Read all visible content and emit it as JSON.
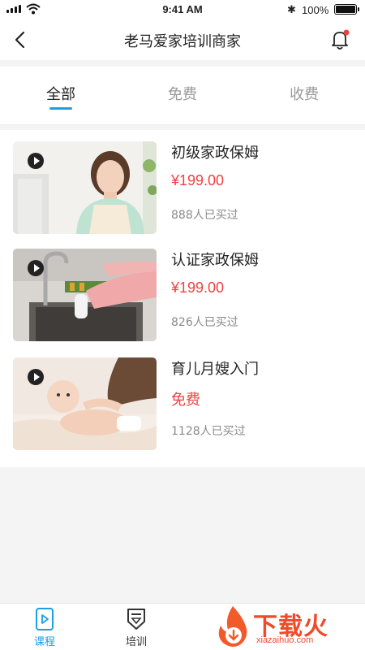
{
  "status_bar": {
    "time": "9:41 AM",
    "battery_percent": "100%",
    "battery_level": 1.0,
    "icons": [
      "signal-icon",
      "wifi-icon",
      "bluetooth-icon",
      "battery-icon"
    ]
  },
  "nav": {
    "title": "老马爱家培训商家",
    "back_icon": "back-arrow-icon",
    "bell_icon": "bell-icon",
    "bell_badge_color": "#f04141"
  },
  "tabs": [
    {
      "label": "全部",
      "active": true
    },
    {
      "label": "免费",
      "active": false
    },
    {
      "label": "收费",
      "active": false
    }
  ],
  "courses": [
    {
      "name": "初级家政保姆",
      "price": "¥199.00",
      "buyers": "888人已买过",
      "thumb": "woman-smiling-photo"
    },
    {
      "name": "认证家政保姆",
      "price": "¥199.00",
      "buyers": "826人已买过",
      "thumb": "sink-cleaning-photo"
    },
    {
      "name": "育儿月嫂入门",
      "price": "免费",
      "buyers": "1128人已买过",
      "thumb": "baby-photo"
    }
  ],
  "bottom_tabs": [
    {
      "label": "课程",
      "icon": "play-video-icon",
      "active": true
    },
    {
      "label": "培训",
      "icon": "certificate-icon",
      "active": false
    }
  ],
  "watermark": {
    "text": "下载火",
    "sub": "xiazaihuo.com"
  },
  "colors": {
    "accent": "#1a9fe6",
    "price": "#f04141",
    "background": "#f4f4f4"
  }
}
